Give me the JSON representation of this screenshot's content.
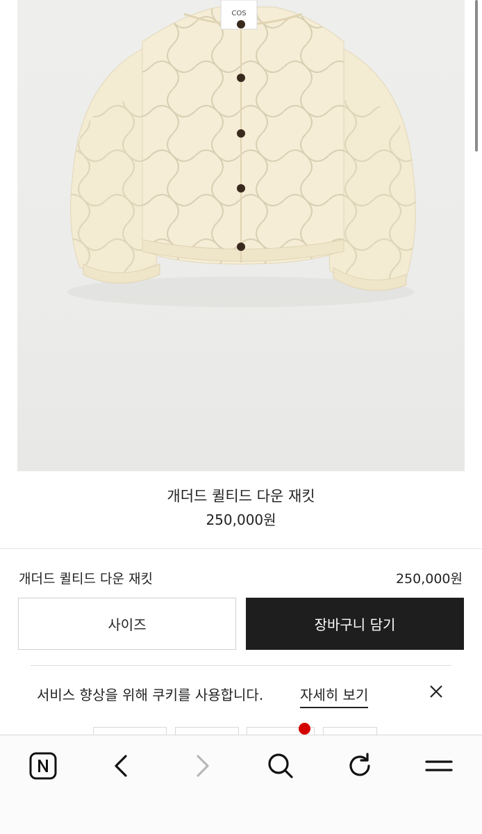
{
  "product": {
    "image_icon": "quilted-jacket-photo",
    "brand_tag": "COS",
    "title": "개더드 퀼티드 다운 재킷",
    "price": "250,000원"
  },
  "sticky_bar": {
    "name": "개더드 퀼티드 다운 재킷",
    "price": "250,000원",
    "size_button": "사이즈",
    "cart_button": "장바구니 담기"
  },
  "cookie_banner": {
    "message": "서비스 향상을 위해 쿠키를 사용합니다.",
    "link": "자세히 보기",
    "close_icon": "close-icon"
  },
  "browser_toolbar": {
    "items": [
      "naver-home-icon",
      "back-icon",
      "forward-icon",
      "search-icon",
      "refresh-icon",
      "menu-icon"
    ]
  },
  "colors": {
    "cart_button_bg": "#1e1e1e",
    "notification_dot": "#d40000"
  }
}
